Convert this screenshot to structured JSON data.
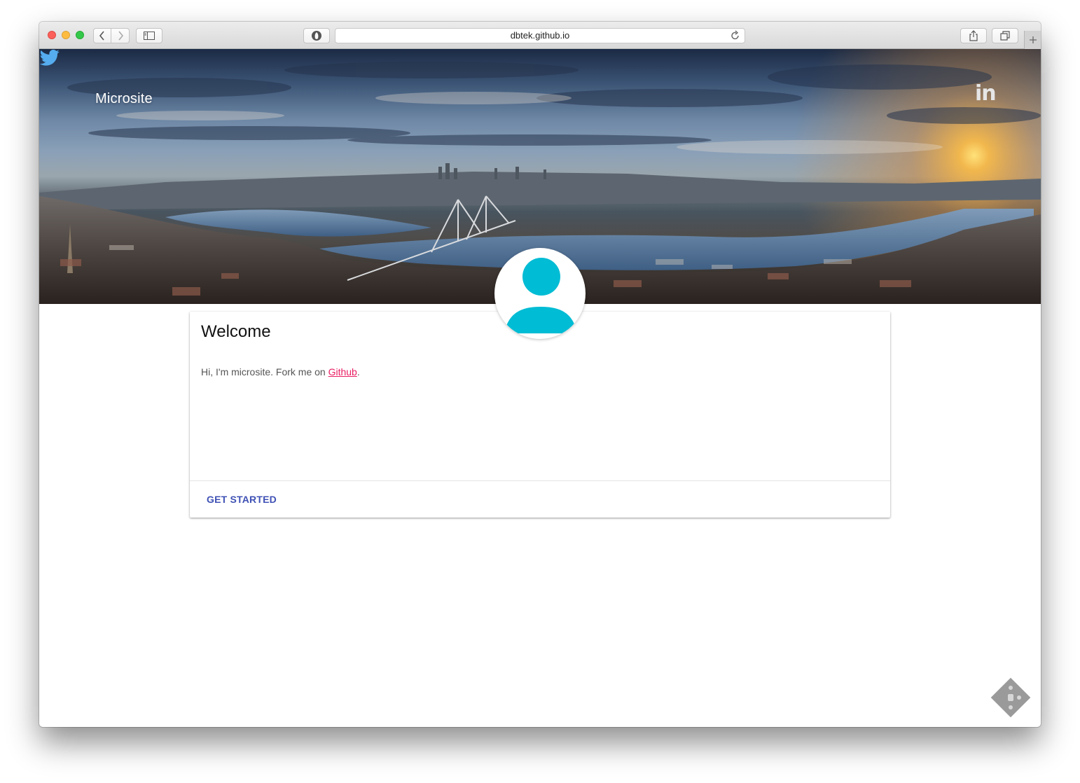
{
  "browser": {
    "url": "dbtek.github.io",
    "icons": {
      "back": "chevron-left-icon",
      "forward": "chevron-right-icon",
      "sidebar": "sidebar-icon",
      "privacy": "shield-icon",
      "reload": "reload-icon",
      "share": "share-icon",
      "tabs": "tabs-overview-icon",
      "new_tab": "plus-icon"
    }
  },
  "header": {
    "brand": "Microsite",
    "social": [
      {
        "name": "twitter-icon",
        "color": "#55acee"
      },
      {
        "name": "linkedin-icon",
        "label": "in",
        "color": "#e6e6e6"
      }
    ]
  },
  "card": {
    "title": "Welcome",
    "text_before_link": "Hi, I'm microsite. Fork me on ",
    "link_text": "Github",
    "text_after_link": ".",
    "action_label": "GET STARTED"
  },
  "colors": {
    "accent": "#3f51b5",
    "link": "#e91e63",
    "avatar": "#00bcd4"
  }
}
